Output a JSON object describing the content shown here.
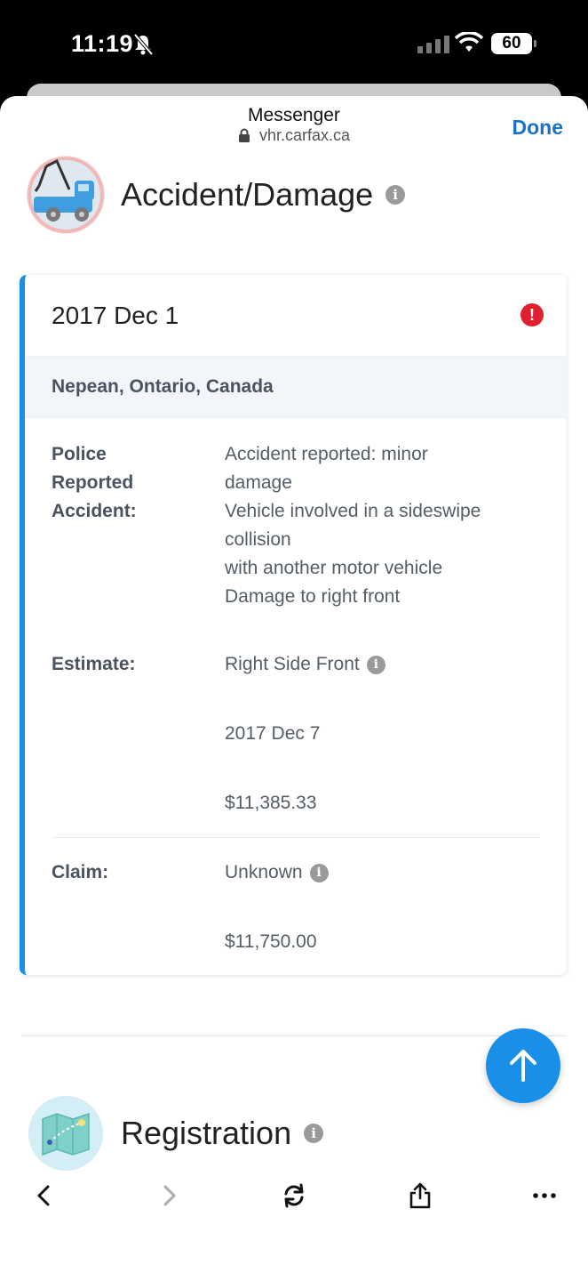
{
  "status_bar": {
    "time": "11:19",
    "battery": "60"
  },
  "browser": {
    "app_name": "Messenger",
    "url": "vhr.carfax.ca",
    "done_label": "Done"
  },
  "accident_section": {
    "title": "Accident/Damage",
    "record": {
      "date": "2017 Dec 1",
      "location": "Nepean, Ontario, Canada",
      "police_label": [
        "Police",
        "Reported",
        "Accident:"
      ],
      "police_lines": [
        "Accident reported: minor",
        "damage",
        "Vehicle involved in a sideswipe",
        "collision",
        "with another motor vehicle",
        "Damage to right front"
      ],
      "estimate_label": "Estimate:",
      "estimate_area": "Right Side Front",
      "estimate_date": "2017 Dec 7",
      "estimate_amount": "$11,385.33",
      "claim_label": "Claim:",
      "claim_status": "Unknown",
      "claim_amount": "$11,750.00"
    }
  },
  "registration_section": {
    "title": "Registration"
  },
  "icons": {
    "info": "i",
    "alert": "!"
  },
  "colors": {
    "accent": "#1a8fe8",
    "link": "#1a73c8",
    "alert": "#e0202e"
  }
}
